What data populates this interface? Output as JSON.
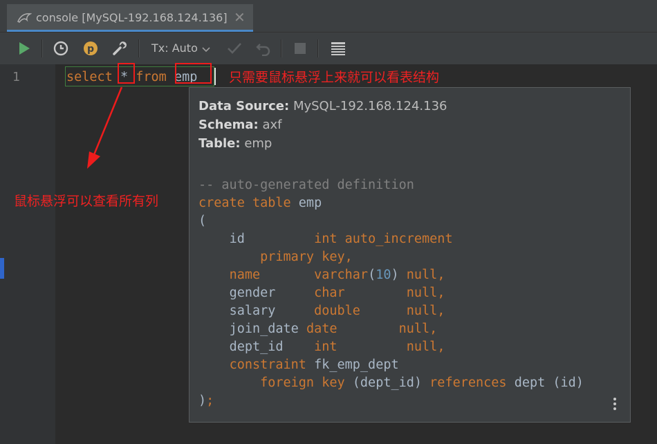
{
  "tab": {
    "title": "console [MySQL-192.168.124.136]",
    "close_glyph": "✕",
    "icon": "mysql-dolphin-icon"
  },
  "toolbar": {
    "tx_label": "Tx: Auto",
    "icons": [
      "run-icon",
      "history-icon",
      "profile-p-icon",
      "wrench-icon",
      "chevron-down-icon",
      "commit-check-icon",
      "rollback-icon",
      "stop-icon",
      "table-view-icon"
    ],
    "run_color": "#59a869",
    "profile_color": "#d9a343"
  },
  "editor": {
    "line_number": "1",
    "tokens": {
      "select": "select",
      "star": "*",
      "from": "from",
      "table": "emp"
    },
    "colors": {
      "keyword": "#cc7832",
      "identifier": "#a9b7c6",
      "number": "#6897bb",
      "comment": "#808080"
    }
  },
  "annotations": {
    "top_note": "只需要鼠标悬浮上来就可以看表结构",
    "left_note": "鼠标悬浮可以查看所有列",
    "color": "#ee1c1c"
  },
  "popup": {
    "data_source_label": "Data Source:",
    "data_source_value": "MySQL-192.168.124.136",
    "schema_label": "Schema:",
    "schema_value": "axf",
    "table_label": "Table:",
    "table_value": "emp",
    "comment": "-- auto-generated definition",
    "create": "create table",
    "table_name": "emp",
    "open_paren": "(",
    "close_paren": ")",
    "semicolon": ";",
    "columns": [
      {
        "name": "id",
        "type": "int",
        "extra": "auto_increment"
      },
      {
        "name": "name",
        "type": "varchar",
        "size": "10",
        "null": "null,"
      },
      {
        "name": "gender",
        "type": "char",
        "null": "null,"
      },
      {
        "name": "salary",
        "type": "double",
        "null": "null,"
      },
      {
        "name": "join_date",
        "type": "date",
        "null": "null,"
      },
      {
        "name": "dept_id",
        "type": "int",
        "null": "null,"
      }
    ],
    "primary_key": "primary key,",
    "constraint_kw": "constraint",
    "constraint_name": "fk_emp_dept",
    "foreign_kw": "foreign key",
    "fk_col": "(dept_id)",
    "references_kw": "references",
    "ref_target": "dept (id)",
    "more_icon": "more-vertical-icon"
  }
}
